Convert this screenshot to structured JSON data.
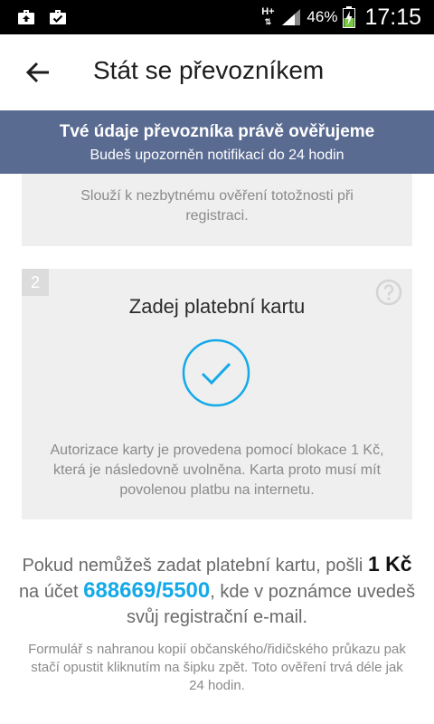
{
  "status_bar": {
    "notification_icons": [
      "briefcase-upload-icon",
      "briefcase-check-icon"
    ],
    "network": "H+",
    "battery": "46%",
    "time": "17:15"
  },
  "app_bar": {
    "back_icon": "arrow-left-icon",
    "title": "Stát se převozníkem"
  },
  "banner": {
    "title": "Tvé údaje převozníka právě ověřujeme",
    "subtitle": "Budeš upozorněn notifikací do 24 hodin",
    "color": "#5a6b91"
  },
  "card1": {
    "text": "Slouží k nezbytnému ověření totožnosti při registraci."
  },
  "card2": {
    "step": "2",
    "title": "Zadej platební kartu",
    "icon": "check-circle-icon",
    "help_icon": "question-circle-icon",
    "text": "Autorizace karty je provedena pomocí blokace 1 Kč, která je následovně uvolněna. Karta proto musí mít povolenou platbu na internetu.",
    "accent": "#14a9e8"
  },
  "info": {
    "part1": "Pokud nemůžeš zadat platební kartu, pošli",
    "amount": "1 Kč",
    "part2": "na účet",
    "account": "688669/5500",
    "part3": ", kde v poznámce uvedeš svůj registrační e-mail.",
    "note": "Formulář s nahranou kopií občanského/řidičského průkazu pak stačí opustit kliknutím na šipku zpět. Toto ověření trvá déle jak 24 hodin."
  }
}
